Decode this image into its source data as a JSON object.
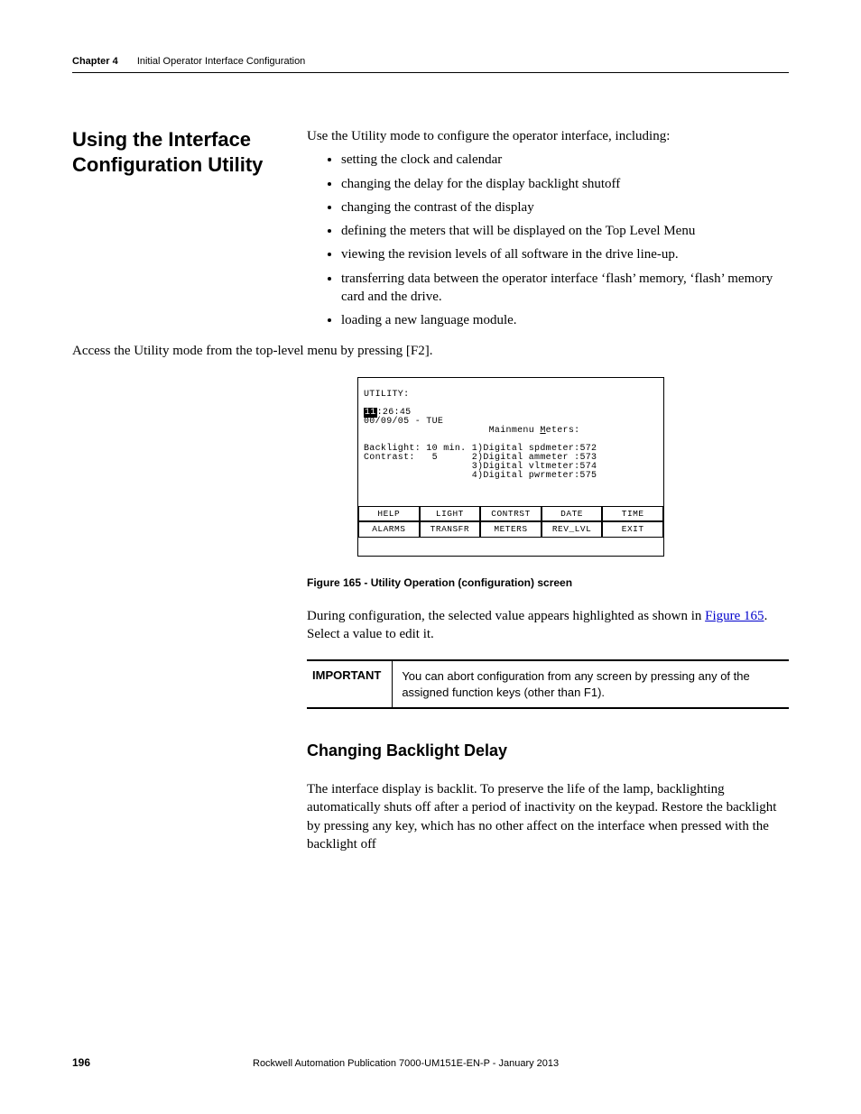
{
  "header": {
    "chapter": "Chapter 4",
    "title": "Initial Operator Interface Configuration"
  },
  "section_heading": "Using the Interface Configuration Utility",
  "intro": "Use the Utility mode to configure the operator interface, including:",
  "bullets": [
    "setting the clock and calendar",
    "changing the delay for the display backlight shutoff",
    "changing the contrast of the display",
    "defining the meters that will be displayed on the Top Level Menu",
    "viewing the revision levels of all software in the drive line-up.",
    "transferring data between the operator interface ‘flash’ memory, ‘flash’ memory card and the drive.",
    "loading a new language module."
  ],
  "access_text": "Access the Utility mode from the top-level menu by pressing [F2].",
  "lcd": {
    "title": "UTILITY:",
    "time_hl": "11",
    "time_rest": ":26:45",
    "date": "00/09/05 - TUE",
    "meters_label_a": "Mainmenu ",
    "meters_label_b": "M",
    "meters_label_c": "eters:",
    "backlight": "Backlight: 10 min.",
    "contrast": "Contrast:   5",
    "meter1": "1)Digital spdmeter:572",
    "meter2": "2)Digital ammeter :573",
    "meter3": "3)Digital vltmeter:574",
    "meter4": "4)Digital pwrmeter:575",
    "row1": [
      "HELP",
      "LIGHT",
      "CONTRST",
      "DATE",
      "TIME"
    ],
    "row2": [
      "ALARMS",
      "TRANSFR",
      "METERS",
      "REV_LVL",
      "EXIT"
    ]
  },
  "figure_caption": "Figure 165 - Utility Operation (configuration) screen",
  "during_text_a": "During configuration, the selected value appears highlighted as shown in ",
  "during_link": "Figure 165",
  "during_text_b": ". Select a value to edit it.",
  "important_label": "IMPORTANT",
  "important_text": "You can abort configuration from any screen by pressing any of the assigned function keys (other than F1).",
  "sub_heading": "Changing Backlight Delay",
  "sub_body": "The interface display is backlit. To preserve the life of the lamp, backlighting automatically shuts off after a period of inactivity on the keypad. Restore the backlight by pressing any key, which has no other affect on the interface when pressed with the backlight off",
  "footer": {
    "page": "196",
    "pub": "Rockwell Automation Publication 7000-UM151E-EN-P - January 2013"
  }
}
